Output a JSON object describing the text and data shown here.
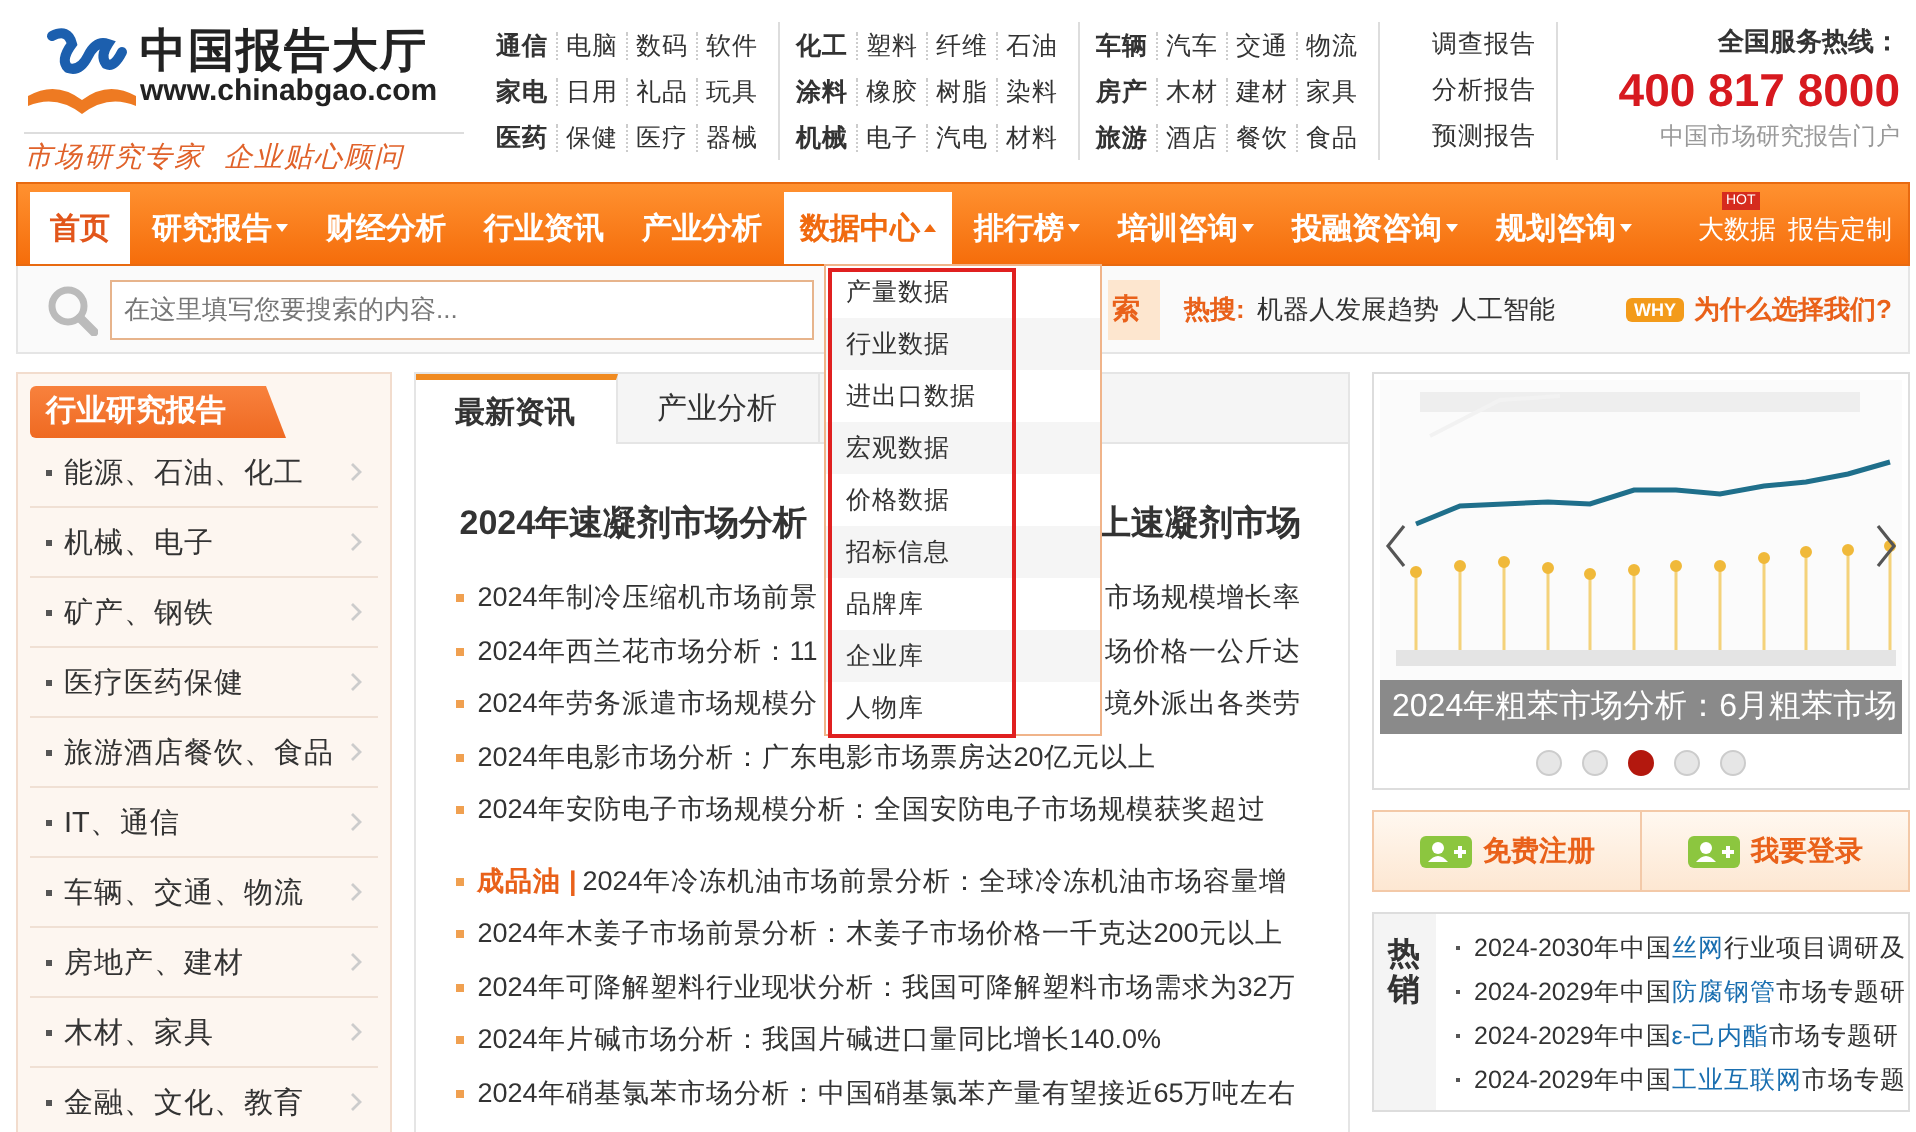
{
  "logo": {
    "name": "中国报告大厅",
    "url": "www.chinabgao.com",
    "slogan": "市场研究专家  企业贴心顾问"
  },
  "category_groups": [
    {
      "rows": [
        [
          "通信",
          "电脑",
          "数码",
          "软件"
        ],
        [
          "家电",
          "日用",
          "礼品",
          "玩具"
        ],
        [
          "医药",
          "保健",
          "医疗",
          "器械"
        ]
      ]
    },
    {
      "rows": [
        [
          "化工",
          "塑料",
          "纤维",
          "石油"
        ],
        [
          "涂料",
          "橡胶",
          "树脂",
          "染料"
        ],
        [
          "机械",
          "电子",
          "汽电",
          "材料"
        ]
      ]
    },
    {
      "rows": [
        [
          "车辆",
          "汽车",
          "交通",
          "物流"
        ],
        [
          "房产",
          "木材",
          "建材",
          "家具"
        ],
        [
          "旅游",
          "酒店",
          "餐饮",
          "食品"
        ]
      ]
    }
  ],
  "report_links": [
    "调查报告",
    "分析报告",
    "预测报告"
  ],
  "hotline": {
    "label": "全国服务热线：",
    "number": "400 817 8000",
    "caption": "中国市场研究报告门户"
  },
  "nav": [
    {
      "label": "首页",
      "selected": true,
      "has_menu": false,
      "expanded": false
    },
    {
      "label": "研究报告",
      "selected": false,
      "has_menu": true,
      "expanded": false
    },
    {
      "label": "财经分析",
      "selected": false,
      "has_menu": false,
      "expanded": false
    },
    {
      "label": "行业资讯",
      "selected": false,
      "has_menu": false,
      "expanded": false
    },
    {
      "label": "产业分析",
      "selected": false,
      "has_menu": false,
      "expanded": false
    },
    {
      "label": "数据中心",
      "selected": false,
      "has_menu": true,
      "expanded": true
    },
    {
      "label": "排行榜",
      "selected": false,
      "has_menu": true,
      "expanded": false
    },
    {
      "label": "培训咨询",
      "selected": false,
      "has_menu": true,
      "expanded": false
    },
    {
      "label": "投融资咨询",
      "selected": false,
      "has_menu": true,
      "expanded": false
    },
    {
      "label": "规划咨询",
      "selected": false,
      "has_menu": true,
      "expanded": false
    }
  ],
  "nav_extras": [
    {
      "label": "大数据",
      "badge": "HOT"
    },
    {
      "label": "报告定制"
    }
  ],
  "dropdown": [
    "产量数据",
    "行业数据",
    "进出口数据",
    "宏观数据",
    "价格数据",
    "招标信息",
    "品牌库",
    "企业库",
    "人物库"
  ],
  "search": {
    "placeholder": "在这里填写您要搜索的内容...",
    "button": "索",
    "hot_label": "热搜:",
    "hot_terms": [
      "机器人发展趋势",
      "人工智能"
    ],
    "why_badge": "WHY",
    "why_link": "为什么选择我们?"
  },
  "sidebar": {
    "title": "行业研究报告",
    "items": [
      "能源、石油、化工",
      "机械、电子",
      "矿产、钢铁",
      "医疗医药保健",
      "旅游酒店餐饮、食品",
      "IT、通信",
      "车辆、交通、物流",
      "房地产、建材",
      "木材、家具",
      "金融、文化、教育"
    ]
  },
  "news": {
    "tabs": [
      {
        "label": "最新资讯",
        "selected": true
      },
      {
        "label": "产业分析",
        "selected": false
      }
    ],
    "headline": {
      "left": "2024年速凝剂市场分析",
      "right": "上速凝剂市场"
    },
    "items": [
      {
        "left": "2024年制冷压缩机市场前景",
        "right": "市场规模增长率"
      },
      {
        "left": "2024年西兰花市场分析：11",
        "right": "场价格一公斤达"
      },
      {
        "left": "2024年劳务派遣市场规模分",
        "right": "境外派出各类劳"
      },
      {
        "text": "2024年电影市场分析：广东电影市场票房达20亿元以上"
      },
      {
        "text": "2024年安防电子市场规模分析：全国安防电子市场规模获奖超过"
      },
      {
        "tag": "成品油 |",
        "text": "2024年冷冻机油市场前景分析：全球冷冻机油市场容量增"
      },
      {
        "text": "2024年木姜子市场前景分析：木姜子市场价格一千克达200元以上"
      },
      {
        "text": "2024年可降解塑料行业现状分析：我国可降解塑料市场需求为32万"
      },
      {
        "text": "2024年片碱市场分析：我国片碱进口量同比增长140.0%"
      },
      {
        "text": "2024年硝基氯苯市场分析：中国硝基氯苯产量有望接近65万吨左右"
      }
    ]
  },
  "carousel": {
    "caption": "2024年粗苯市场分析：6月粗苯市场",
    "dots": [
      {
        "selected": false
      },
      {
        "selected": false
      },
      {
        "selected": true
      },
      {
        "selected": false
      },
      {
        "selected": false
      }
    ]
  },
  "account_buttons": [
    "免费注册",
    "我要登录"
  ],
  "hot_sales": {
    "label": "热销",
    "items": [
      {
        "pre": "2024-2030年中国",
        "link": "丝网",
        "post": "行业项目调研及"
      },
      {
        "pre": "2024-2029年中国",
        "link": "防腐钢管",
        "post": "市场专题研"
      },
      {
        "pre": "2024-2029年中国",
        "link": "ε-己内酯",
        "post": "市场专题研"
      },
      {
        "pre": "2024-2029年中国",
        "link": "工业互联网",
        "post": "市场专题"
      }
    ]
  }
}
